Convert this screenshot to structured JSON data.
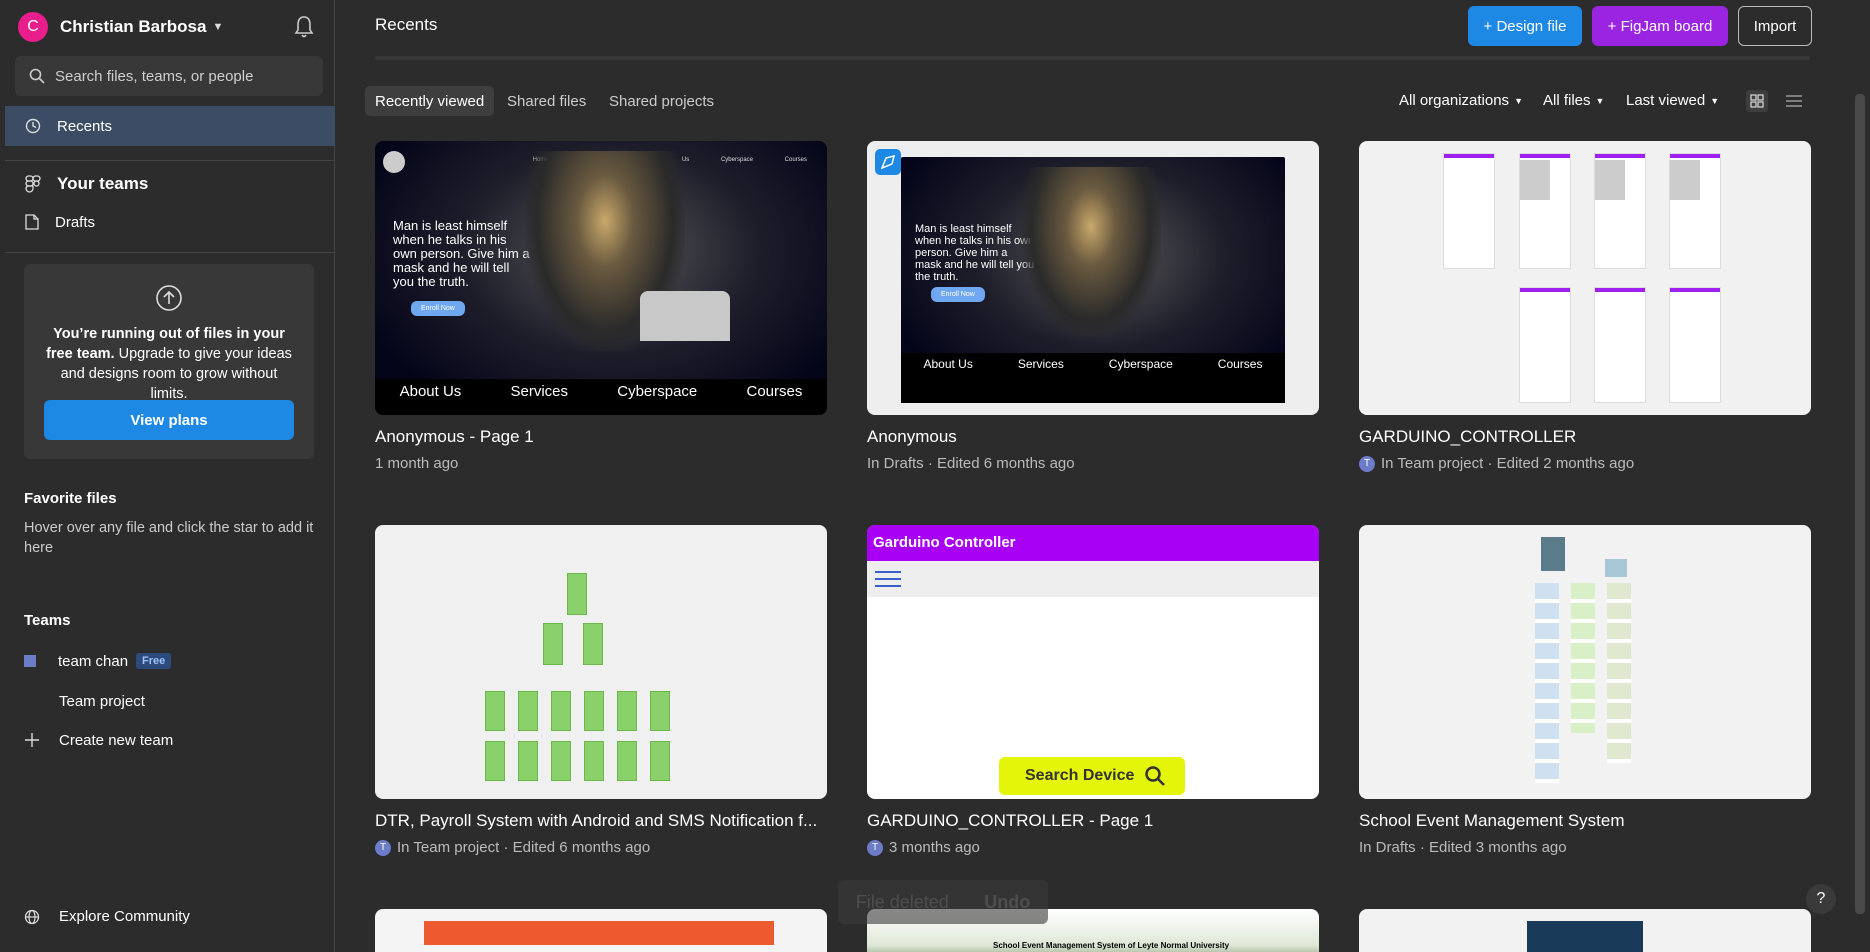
{
  "user": {
    "initial": "C",
    "name": "Christian Barbosa"
  },
  "search": {
    "placeholder": "Search files, teams, or people"
  },
  "nav": {
    "recents": "Recents",
    "your_teams": "Your teams",
    "drafts": "Drafts"
  },
  "upgrade": {
    "text_bold": "You’re running out of files in your free team.",
    "text_rest": " Upgrade to give your ideas and designs room to grow without limits.",
    "button": "View plans"
  },
  "favorites": {
    "title": "Favorite files",
    "text": "Hover over any file and click the star to add it here"
  },
  "teams": {
    "title": "Teams",
    "team_name": "team chan",
    "badge": "Free",
    "project": "Team project",
    "create": "Create new team"
  },
  "explore": "Explore Community",
  "header": {
    "title": "Recents",
    "design_btn": "+ Design file",
    "figjam_btn": "+ FigJam board",
    "import_btn": "Import"
  },
  "tabs": [
    "Recently viewed",
    "Shared files",
    "Shared projects"
  ],
  "filters": [
    "All organizations",
    "All files",
    "Last viewed"
  ],
  "cards": [
    {
      "title": "Anonymous - Page 1",
      "sub": "1 month ago",
      "avatar": ""
    },
    {
      "title": "Anonymous",
      "sub": "In Drafts · Edited 6 months ago",
      "avatar": ""
    },
    {
      "title": "GARDUINO_CONTROLLER",
      "sub": "In Team project · Edited 2 months ago",
      "avatar": "T"
    },
    {
      "title": "DTR, Payroll System with Android and SMS Notification f...",
      "sub": "In Team project · Edited 6 months ago",
      "avatar": "T"
    },
    {
      "title": "GARDUINO_CONTROLLER - Page 1",
      "sub": "3 months ago",
      "avatar": "T"
    },
    {
      "title": "School Event Management System",
      "sub": "In Drafts · Edited 3 months ago",
      "avatar": ""
    }
  ],
  "thumbs": {
    "hack_nav": "Home Services About Us Cyberspace Courses",
    "hack_quote": "Man is least himself when he talks in his own person. Give him a mask and he will tell you the truth.",
    "hack_btn": "Enroll Now",
    "hack_foot": [
      "About Us",
      "Services",
      "Cyberspace",
      "Courses"
    ],
    "garduino_header": "Garduino Controller",
    "garduino_search": "Search Device",
    "school_caption": "School Event Management System of Leyte Normal University"
  },
  "toast": {
    "message": "File deleted",
    "action": "Undo"
  },
  "help": "?"
}
